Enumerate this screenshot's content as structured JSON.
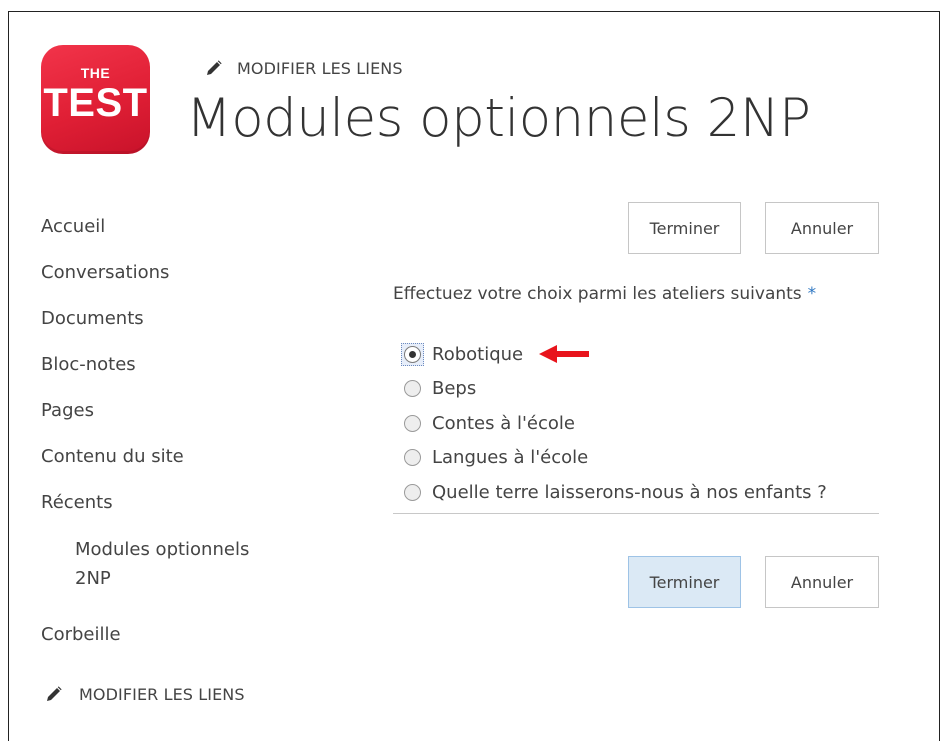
{
  "header": {
    "logo_top": "THE",
    "logo_main": "TEST",
    "edit_links": "MODIFIER LES LIENS",
    "title": "Modules optionnels 2NP"
  },
  "nav": {
    "items": [
      {
        "label": "Accueil"
      },
      {
        "label": "Conversations"
      },
      {
        "label": "Documents"
      },
      {
        "label": "Bloc-notes"
      },
      {
        "label": "Pages"
      },
      {
        "label": "Contenu du site"
      },
      {
        "label": "Récents"
      }
    ],
    "recent_sub": [
      "Modules optionnels",
      "2NP"
    ],
    "trash": "Corbeille",
    "edit_links": "MODIFIER LES LIENS"
  },
  "form": {
    "top_buttons": {
      "finish": "Terminer",
      "cancel": "Annuler"
    },
    "question": "Effectuez votre choix parmi les ateliers suivants",
    "required_mark": "*",
    "options": [
      {
        "label": "Robotique",
        "checked": true
      },
      {
        "label": "Beps",
        "checked": false
      },
      {
        "label": "Contes à l'école",
        "checked": false
      },
      {
        "label": "Langues à l'école",
        "checked": false
      },
      {
        "label": "Quelle terre laisserons-nous à nos enfants ?",
        "checked": false
      }
    ],
    "bottom_buttons": {
      "finish": "Terminer",
      "cancel": "Annuler"
    }
  },
  "colors": {
    "logo_red": "#e62139",
    "primary_button_bg": "#dbe9f5",
    "annotation_arrow": "#e8141c",
    "required_star": "#2f77c2"
  },
  "icons": {
    "edit": "pencil-icon",
    "annotation": "red-arrow-icon"
  }
}
